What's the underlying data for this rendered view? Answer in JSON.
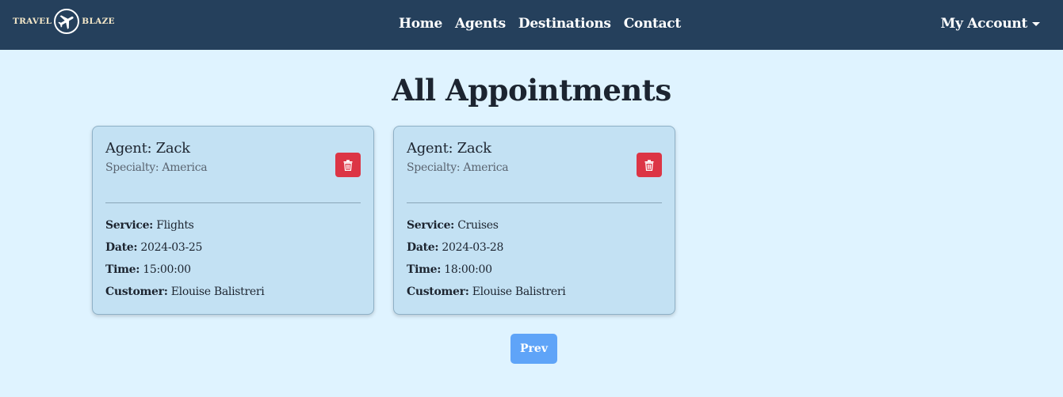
{
  "brand": {
    "left_text": "TRAVEL",
    "right_text": "BLAZE",
    "icon": "airplane-icon"
  },
  "nav": {
    "links": [
      "Home",
      "Agents",
      "Destinations",
      "Contact"
    ],
    "account_label": "My Account",
    "account_icon": "caret-down-icon"
  },
  "page": {
    "title": "All Appointments"
  },
  "labels": {
    "service": "Service:",
    "date": "Date:",
    "time": "Time:",
    "customer": "Customer:"
  },
  "appointments": [
    {
      "agent": "Agent: Zack",
      "specialty": "Specialty: America",
      "service": "Flights",
      "date": "2024-03-25",
      "time": "15:00:00",
      "customer": "Elouise Balistreri"
    },
    {
      "agent": "Agent: Zack",
      "specialty": "Specialty: America",
      "service": "Cruises",
      "date": "2024-03-28",
      "time": "18:00:00",
      "customer": "Elouise Balistreri"
    }
  ],
  "pagination": {
    "prev_label": "Prev"
  },
  "colors": {
    "navbar": "#25405c",
    "background": "#dff3ff",
    "card": "#c3e1f3",
    "delete": "#dc3545",
    "prev_button": "#5fa4f8"
  }
}
